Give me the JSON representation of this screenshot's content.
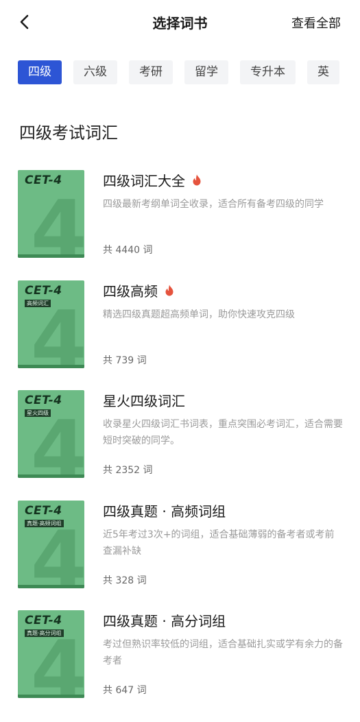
{
  "header": {
    "title": "选择词书",
    "action_label": "查看全部"
  },
  "categories": [
    {
      "label": "四级"
    },
    {
      "label": "六级"
    },
    {
      "label": "考研"
    },
    {
      "label": "留学"
    },
    {
      "label": "专升本"
    },
    {
      "label": "英"
    }
  ],
  "section": {
    "title": "四级考试词汇"
  },
  "books": [
    {
      "cover_text": "CET-4",
      "cover_sub": "",
      "cover_num": "4",
      "title": "四级词汇大全",
      "hot": true,
      "description": "四级最新考纲单词全收录，适合所有备考四级的同学",
      "count": "共 4440 词"
    },
    {
      "cover_text": "CET-4",
      "cover_sub": "高频词汇",
      "cover_num": "4",
      "title": "四级高频",
      "hot": true,
      "description": "精选四级真题超高频单词，助你快速攻克四级",
      "count": "共 739 词"
    },
    {
      "cover_text": "CET-4",
      "cover_sub": "星火四级",
      "cover_num": "4",
      "title": "星火四级词汇",
      "hot": false,
      "description": "收录星火四级词汇书词表，重点突围必考词汇，适合需要短时突破的同学。",
      "count": "共 2352 词"
    },
    {
      "cover_text": "CET-4",
      "cover_sub": "真题·高频词组",
      "cover_num": "4",
      "title": "四级真题 · 高频词组",
      "hot": false,
      "description": "近5年考过3次+的词组，适合基础薄弱的备考者或考前查漏补缺",
      "count": "共 328 词"
    },
    {
      "cover_text": "CET-4",
      "cover_sub": "真题·高分词组",
      "cover_num": "4",
      "title": "四级真题 · 高分词组",
      "hot": false,
      "description": "考过但熟识率较低的词组，适合基础扎实或学有余力的备考者",
      "count": "共 647 词"
    }
  ],
  "colors": {
    "accent": "#2d55d5",
    "cover": "#6dbb85",
    "hot": "#e5533d"
  },
  "icons": {
    "back": "chevron-left-icon",
    "hot": "fire-icon"
  }
}
